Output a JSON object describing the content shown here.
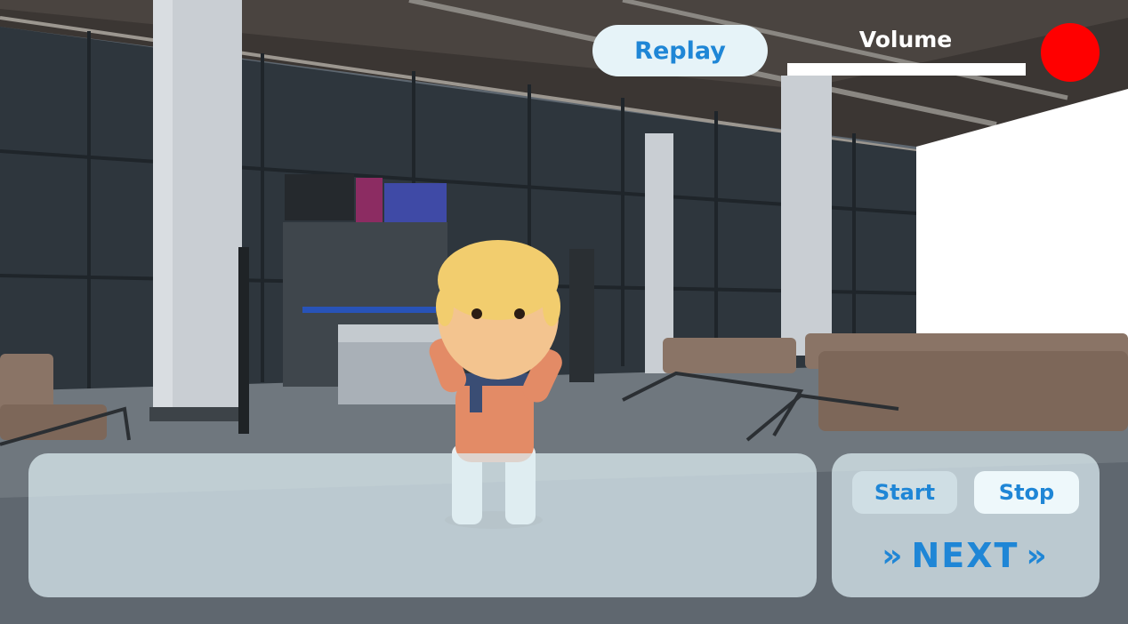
{
  "hud": {
    "replay_label": "Replay",
    "volume_label": "Volume",
    "volume_level": 1.0,
    "record_color": "#ff0000"
  },
  "dialog": {
    "text": ""
  },
  "controls": {
    "start_label": "Start",
    "stop_label": "Stop",
    "next_label": "NEXT",
    "next_chevron_left": "»",
    "next_chevron_right": "»",
    "accent_color": "#1f86d6"
  },
  "scene": {
    "setting": "airport departure lounge",
    "character": "blonde child with scarf"
  }
}
